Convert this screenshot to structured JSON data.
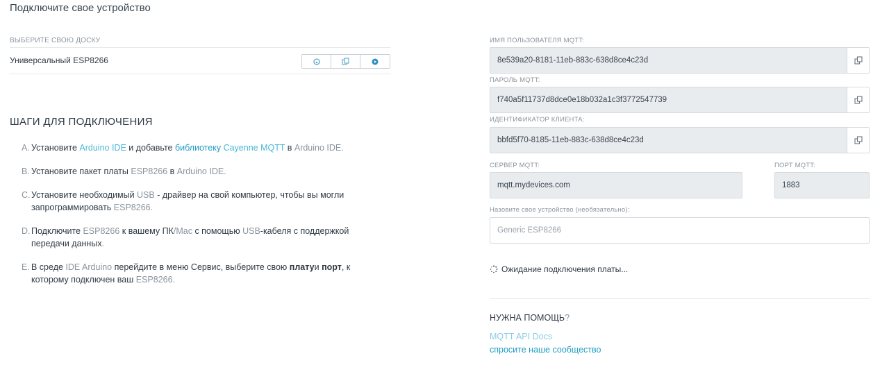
{
  "page": {
    "title": "Подключите свое устройство"
  },
  "board": {
    "label": "ВЫБЕРИТЕ СВОЮ ДОСКУ",
    "name": "Универсальный ESP8266",
    "actions": [
      "github-icon",
      "copy-icon",
      "play-icon"
    ]
  },
  "steps": {
    "title": "ШАГИ ДЛЯ ПОДКЛЮЧЕНИЯ",
    "a": {
      "letter": "A.",
      "t1": "Установите ",
      "l1": "Arduino IDE",
      "t2": " и добавьте ",
      "l2": "библиотеку",
      "t3": " ",
      "l3": "Cayenne MQTT",
      "t4": " в ",
      "m1": "Arduino IDE."
    },
    "b": {
      "letter": "B.",
      "t1": "Установите пакет платы ",
      "m1": "ESP8266",
      "t2": " в ",
      "m2": "Arduino IDE."
    },
    "c": {
      "letter": "C.",
      "t1": "Установите необходимый ",
      "m1": "USB",
      "t2": " - драйвер на свой компьютер, чтобы вы могли запрограммировать ",
      "m2": "ESP8266."
    },
    "d": {
      "letter": "D.",
      "t1": "Подключите ",
      "m1": "ESP8266",
      "t2": " к вашему ПК",
      "m2": "/Mac",
      "t3": " с помощью ",
      "m3": "USB",
      "t4": "-кабеля с поддержкой передачи данных",
      "m4": "."
    },
    "e": {
      "letter": "E.",
      "t1": "В среде ",
      "m1": "IDE Arduino",
      "t2": " перейдите в меню Сервис, выберите свою ",
      "b1": "плату",
      "t3": "и ",
      "b2": "порт",
      "t4": ", к которому подключен ваш ",
      "m2": "ESP8266."
    }
  },
  "mqtt": {
    "username_label": "ИМЯ ПОЛЬЗОВАТЕЛЯ MQTT:",
    "username": "8e539a20-8181-11eb-883c-638d8ce4c23d",
    "password_label": "ПАРОЛЬ MQTT:",
    "password": "f740a5f11737d8dce0e18b032a1c3f3772547739",
    "client_id_label": "ИДЕНТИФИКАТОР КЛИЕНТА:",
    "client_id": "bbfd5f70-8185-11eb-883c-638d8ce4c23d",
    "server_label": "СЕРВЕР MQTT:",
    "server": "mqtt.mydevices.com",
    "port_label": "ПОРТ MQTT:",
    "port": "1883",
    "device_name_label": "Назовите свое устройство (необязательно):",
    "device_name_placeholder": "Generic ESP8266"
  },
  "status": {
    "waiting": "Ожидание подключения платы..."
  },
  "help": {
    "title": "НУЖНА ПОМОЩЬ",
    "title_q": "?",
    "link1": "MQTT API Docs",
    "link2": "спросите наше сообщество"
  },
  "colors": {
    "link": "#4ab8d6",
    "link_dark": "#1e9cc4",
    "muted": "#8a949e",
    "readonly_bg": "#e9ecef"
  }
}
